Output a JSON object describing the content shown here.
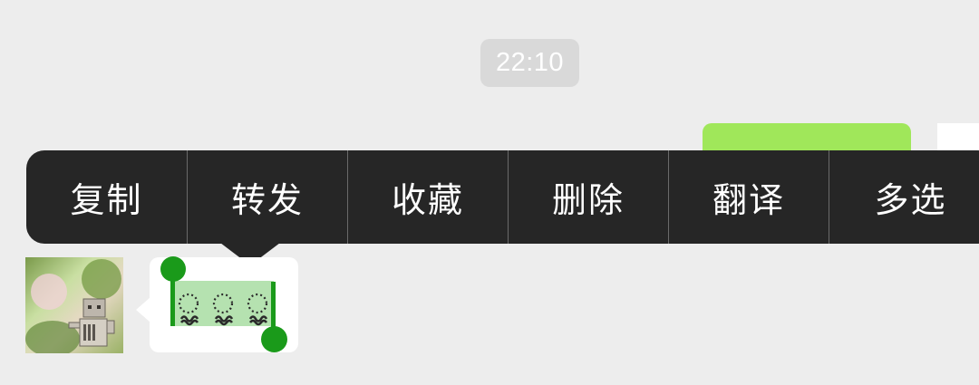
{
  "chat": {
    "timestamp": "22:10"
  },
  "context_menu": {
    "items": [
      {
        "label": "复制"
      },
      {
        "label": "转发"
      },
      {
        "label": "收藏"
      },
      {
        "label": "删除"
      },
      {
        "label": "翻译"
      },
      {
        "label": "多选"
      }
    ]
  },
  "incoming_message": {
    "emoji_icons": [
      "flower-face-emoji-icon",
      "flower-face-emoji-icon",
      "flower-face-emoji-icon"
    ],
    "selection_color": "#b5e2b0",
    "handle_color": "#1a9a1a"
  },
  "outgoing_message": {
    "bubble_color": "#a0e75a"
  },
  "colors": {
    "background": "#ededed",
    "menu_background": "#262626",
    "menu_text": "#ffffff",
    "timestamp_background": "#d9d9d9"
  }
}
